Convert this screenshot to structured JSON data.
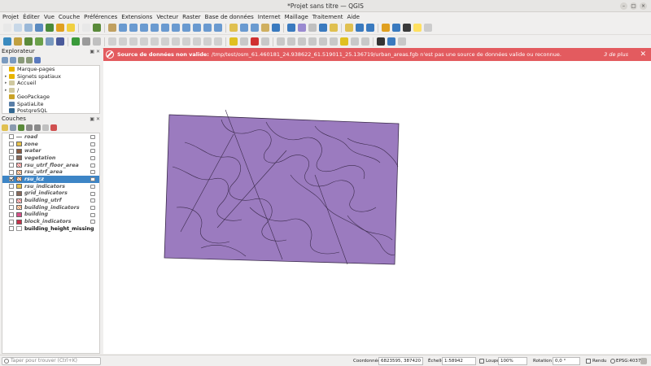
{
  "window": {
    "title": "*Projet sans titre — QGIS"
  },
  "menu": [
    "Projet",
    "Éditer",
    "Vue",
    "Couche",
    "Préférences",
    "Extensions",
    "Vecteur",
    "Raster",
    "Base de données",
    "Internet",
    "Maillage",
    "Traitement",
    "Aide"
  ],
  "message": {
    "title": "Source de données non valide:",
    "text": "/tmp/test/osm_61.460181_24.938622_61.519011_25.136719/urban_areas.fgb n'est pas une source de données valide ou reconnue.",
    "more": "3 de plus",
    "close": "✕"
  },
  "browser": {
    "title": "Explorateur",
    "items": [
      {
        "label": "Marque-pages",
        "icon": "star-icon",
        "color": "#e8b400",
        "arrow": ""
      },
      {
        "label": "Signets spatiaux",
        "icon": "star-icon",
        "color": "#e8b400",
        "arrow": "▸"
      },
      {
        "label": "Accueil",
        "icon": "folder-icon",
        "color": "#d0c9a0",
        "arrow": "▸"
      },
      {
        "label": "/",
        "icon": "folder-icon",
        "color": "#d0c9a0",
        "arrow": "▸"
      },
      {
        "label": "GeoPackage",
        "icon": "geopackage-icon",
        "color": "#c9a227",
        "arrow": ""
      },
      {
        "label": "SpatiaLite",
        "icon": "spatialite-icon",
        "color": "#5a7fa8",
        "arrow": ""
      },
      {
        "label": "PostgreSQL",
        "icon": "postgresql-icon",
        "color": "#336791",
        "arrow": ""
      }
    ]
  },
  "layers": {
    "title": "Couches",
    "items": [
      {
        "label": "road",
        "checked": false,
        "swatch": "line",
        "color": "#777777"
      },
      {
        "label": "zone",
        "checked": false,
        "swatch": "fill",
        "color": "#e7c24a"
      },
      {
        "label": "water",
        "checked": false,
        "swatch": "fill",
        "color": "#8a5a40"
      },
      {
        "label": "vegetation",
        "checked": false,
        "swatch": "fill",
        "color": "#8a6a5a"
      },
      {
        "label": "rsu_utrf_floor_area",
        "checked": false,
        "swatch": "pattern",
        "color": "#e06060"
      },
      {
        "label": "rsu_utrf_area",
        "checked": false,
        "swatch": "pattern",
        "color": "#e0803a"
      },
      {
        "label": "rsu_lcz",
        "checked": true,
        "swatch": "pattern",
        "color": "#e08040",
        "selected": true
      },
      {
        "label": "rsu_indicators",
        "checked": false,
        "swatch": "fill",
        "color": "#e7c24a"
      },
      {
        "label": "grid_indicators",
        "checked": false,
        "swatch": "fill",
        "color": "#8a6a5a"
      },
      {
        "label": "building_utrf",
        "checked": false,
        "swatch": "pattern",
        "color": "#e06060"
      },
      {
        "label": "building_indicators",
        "checked": false,
        "swatch": "pattern",
        "color": "#e0803a"
      },
      {
        "label": "building",
        "checked": false,
        "swatch": "fill",
        "color": "#d8508a"
      },
      {
        "label": "block_indicators",
        "checked": false,
        "swatch": "fill",
        "color": "#c8304a"
      },
      {
        "label": "building_height_missing",
        "checked": false,
        "swatch": "table",
        "color": "#bbbbbb",
        "plain": true
      }
    ]
  },
  "map": {
    "polygon_fill": "#9b7bbf",
    "polygon_stroke": "#3a2a4a"
  },
  "status": {
    "search_placeholder": "Taper pour trouver (Ctrl+K)",
    "coord_label": "Coordonnée",
    "coord_value": "6823595, 387420",
    "scale_label": "Échelle",
    "scale_value": "1:58942",
    "magnifier_label": "Loupe",
    "magnifier_value": "100%",
    "rotation_label": "Rotation",
    "rotation_value": "0,0 °",
    "render_label": "Rendu",
    "crs": "EPSG:4037"
  }
}
